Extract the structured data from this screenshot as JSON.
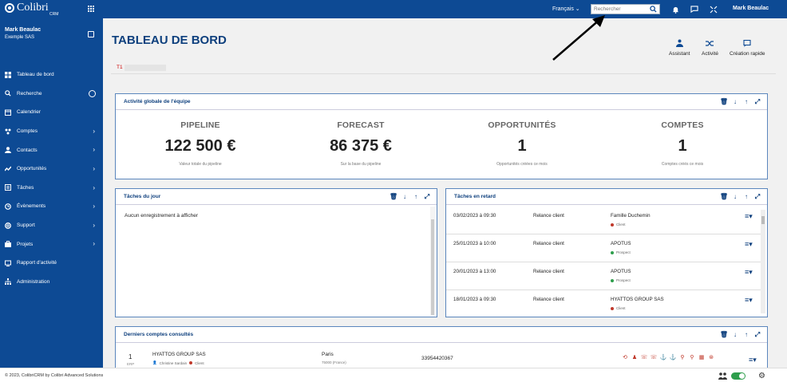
{
  "app": {
    "logo": "Colibri",
    "logo_sub": "CRM"
  },
  "header": {
    "language": "Français",
    "search_placeholder": "Rechercher",
    "user": "Mark Beaulac"
  },
  "sidebar": {
    "user_name": "Mark Beaulac",
    "user_org": "Exemple SAS",
    "items": [
      {
        "label": "Tableau de bord",
        "icon": "dashboard-icon"
      },
      {
        "label": "Recherche",
        "icon": "search-icon"
      },
      {
        "label": "Calendrier",
        "icon": "calendar-icon"
      },
      {
        "label": "Comptes",
        "icon": "accounts-icon"
      },
      {
        "label": "Contacts",
        "icon": "contacts-icon"
      },
      {
        "label": "Opportunités",
        "icon": "opportunities-icon"
      },
      {
        "label": "Tâches",
        "icon": "tasks-icon"
      },
      {
        "label": "Évènements",
        "icon": "events-icon"
      },
      {
        "label": "Support",
        "icon": "support-icon"
      },
      {
        "label": "Projets",
        "icon": "projects-icon"
      },
      {
        "label": "Rapport d'activité",
        "icon": "report-icon"
      },
      {
        "label": "Administration",
        "icon": "admin-icon"
      }
    ]
  },
  "page": {
    "title": "TABLEAU DE BORD",
    "tab_prefix": "T1"
  },
  "quick_actions": [
    {
      "label": "Assistant"
    },
    {
      "label": "Activité"
    },
    {
      "label": "Création rapide"
    }
  ],
  "team_panel": {
    "title": "Activité globale de l'équipe",
    "kpis": [
      {
        "label": "PIPELINE",
        "value": "122 500 €",
        "sub": "Valeur totale du pipeline"
      },
      {
        "label": "FORECAST",
        "value": "86 375 €",
        "sub": "Sur la base du pipeline"
      },
      {
        "label": "OPPORTUNITÉS",
        "value": "1",
        "sub": "Opportunités créées ce mois"
      },
      {
        "label": "COMPTES",
        "value": "1",
        "sub": "Comptes créés ce mois"
      }
    ]
  },
  "today_panel": {
    "title": "Tâches du jour",
    "empty": "Aucun enregistrement à afficher"
  },
  "late_panel": {
    "title": "Tâches en retard",
    "rows": [
      {
        "date": "03/02/2023 à 09:30",
        "action": "Relance client",
        "contact": "Famille Duchemin",
        "status": "Client",
        "status_color": "#c0392b"
      },
      {
        "date": "25/01/2023 à 10:00",
        "action": "Relance client",
        "contact": "APOTUS",
        "status": "Prospect",
        "status_color": "#2e9e4c"
      },
      {
        "date": "20/01/2023 à 13:00",
        "action": "Relance client",
        "contact": "APOTUS",
        "status": "Prospect",
        "status_color": "#2e9e4c"
      },
      {
        "date": "18/01/2023 à 09:30",
        "action": "Relance client",
        "contact": "HYATTOS GROUP SAS",
        "status": "Client",
        "status_color": "#c0392b"
      }
    ]
  },
  "recent_panel": {
    "title": "Derniers comptes consultés",
    "row": {
      "num": "1",
      "tag": "ERP",
      "name": "HYATTOS GROUP SAS",
      "owner": "Christine Sardain",
      "status": "Client",
      "city": "Paris",
      "zip": "75000 (France)",
      "phone": "33954420367"
    }
  },
  "footer": {
    "text": "© 2023, ColibriCRM by Colibri Advanced Solutions"
  }
}
